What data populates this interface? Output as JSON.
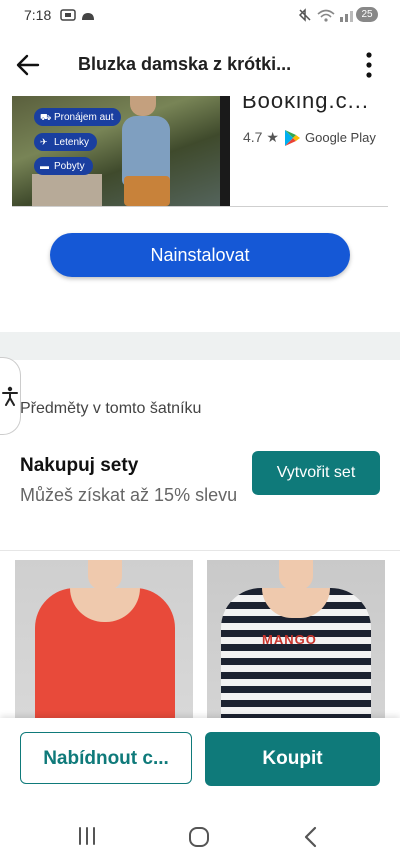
{
  "status_bar": {
    "time": "7:18",
    "battery": "25"
  },
  "header": {
    "title": "Bluzka damska z krótki..."
  },
  "ad": {
    "tags": [
      "Pronájem aut",
      "Letenky",
      "Pobyty"
    ],
    "app_name": "Booking.c...",
    "rating": "4.7 ★",
    "store_label": "Google Play",
    "install_label": "Nainstalovat"
  },
  "wardrobe": {
    "heading": "Předměty v tomto šatníku"
  },
  "bundle": {
    "title": "Nakupuj sety",
    "description": "Můžeš získat až 15% slevu",
    "create_set_label": "Vytvořit set"
  },
  "items": [
    {
      "icon": "red-tshirt"
    },
    {
      "icon": "striped-tshirt",
      "print_text": "MANGO"
    }
  ],
  "actions": {
    "offer_label": "Nabídnout c...",
    "buy_label": "Koupit"
  },
  "colors": {
    "accent": "#0f7a7a",
    "install_button": "#1558d6",
    "ad_tag": "#1a3fa0"
  }
}
